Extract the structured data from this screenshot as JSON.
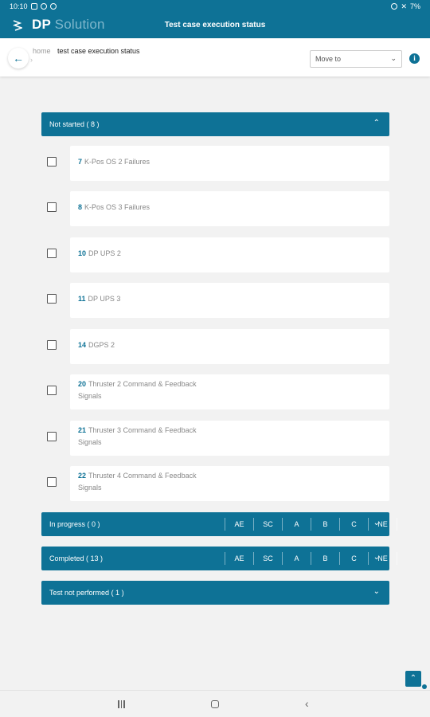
{
  "status_bar": {
    "time": "10:10",
    "battery": "7%"
  },
  "app": {
    "brand_primary": "DP",
    "brand_secondary": "Solution",
    "title": "Test case execution status",
    "color_brand": "#0e7296"
  },
  "breadcrumb": {
    "home": "home",
    "current": "test case execution status"
  },
  "move_to": {
    "value": "Move to"
  },
  "info_icon": "i",
  "sections": {
    "not_started": {
      "label": "Not started",
      "count": "( 8 )"
    },
    "in_progress": {
      "label": "In progress",
      "count": "( 0 )"
    },
    "completed": {
      "label": "Completed",
      "count": "( 13 )"
    },
    "not_performed": {
      "label": "Test not performed",
      "count": "( 1 )"
    }
  },
  "columns": [
    "AE",
    "SC",
    "A",
    "B",
    "C",
    "NE"
  ],
  "tests": [
    {
      "number": "7",
      "name": "K-Pos OS 2 Failures"
    },
    {
      "number": "8",
      "name": "K-Pos OS 3 Failures"
    },
    {
      "number": "10",
      "name": "DP UPS 2"
    },
    {
      "number": "11",
      "name": "DP UPS 3"
    },
    {
      "number": "14",
      "name": "DGPS 2"
    },
    {
      "number": "20",
      "name": "Thruster 2 Command & Feedback Signals"
    },
    {
      "number": "21",
      "name": "Thruster 3 Command & Feedback Signals"
    },
    {
      "number": "22",
      "name": "Thruster 4 Command & Feedback Signals"
    }
  ]
}
